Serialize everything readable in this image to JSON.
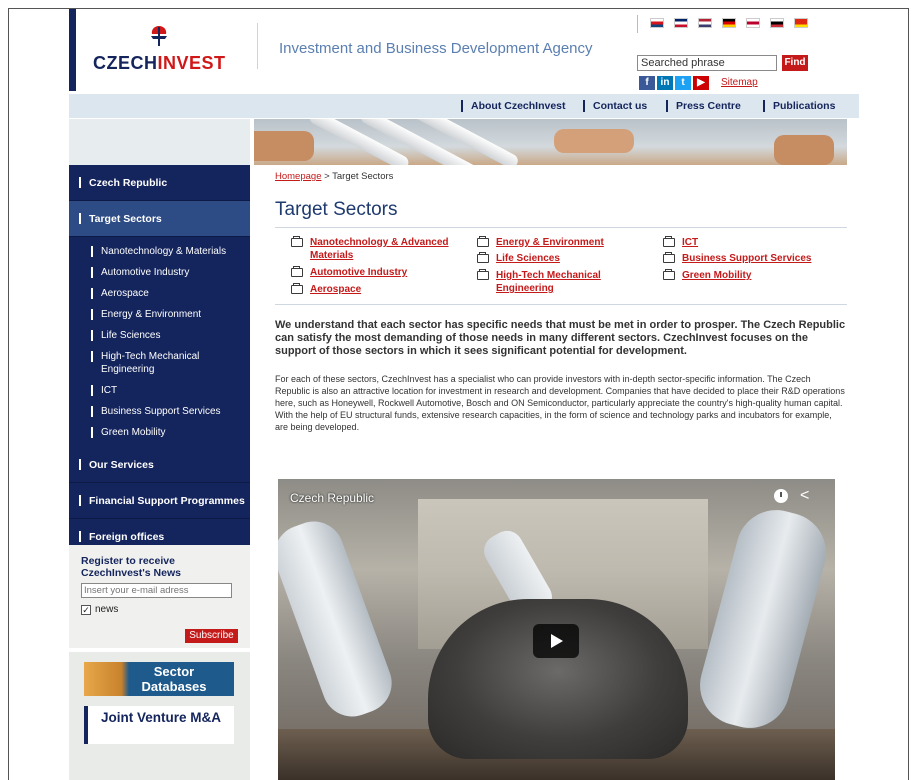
{
  "header": {
    "logo_text_a": "CZECH",
    "logo_text_b": "INVEST",
    "tagline": "Investment and Business Development Agency",
    "search_placeholder": "Searched phrase",
    "find_label": "Find",
    "sitemap_label": "Sitemap",
    "flags": [
      {
        "name": "czech-flag-icon",
        "colors": [
          "#ffffff",
          "#d7141a",
          "#11457e"
        ]
      },
      {
        "name": "uk-flag-icon",
        "colors": [
          "#012169",
          "#ffffff",
          "#c8102e"
        ]
      },
      {
        "name": "us-flag-icon",
        "colors": [
          "#b22234",
          "#ffffff",
          "#3c3b6e"
        ]
      },
      {
        "name": "germany-flag-icon",
        "colors": [
          "#000000",
          "#dd0000",
          "#ffce00"
        ]
      },
      {
        "name": "japan-flag-icon",
        "colors": [
          "#ffffff",
          "#bc002d",
          "#ffffff"
        ]
      },
      {
        "name": "korea-flag-icon",
        "colors": [
          "#ffffff",
          "#000000",
          "#cd2e3a"
        ]
      },
      {
        "name": "china-flag-icon",
        "colors": [
          "#de2910",
          "#de2910",
          "#ffde00"
        ]
      }
    ],
    "social": [
      {
        "name": "facebook-icon",
        "glyph": "f",
        "color": "#3b5998"
      },
      {
        "name": "linkedin-icon",
        "glyph": "in",
        "color": "#0077b5"
      },
      {
        "name": "twitter-icon",
        "glyph": "t",
        "color": "#1da1f2"
      },
      {
        "name": "youtube-icon",
        "glyph": "▶",
        "color": "#cc0000"
      }
    ]
  },
  "topnav": [
    {
      "label": "About CzechInvest"
    },
    {
      "label": "Contact us"
    },
    {
      "label": "Press Centre"
    },
    {
      "label": "Publications"
    }
  ],
  "sidebar": {
    "top_items": [
      {
        "label": "Czech Republic"
      },
      {
        "label": "Target Sectors"
      }
    ],
    "sub_items": [
      {
        "label": "Nanotechnology & Materials"
      },
      {
        "label": "Automotive Industry"
      },
      {
        "label": "Aerospace"
      },
      {
        "label": "Energy & Environment"
      },
      {
        "label": "Life Sciences"
      },
      {
        "label": "High-Tech Mechanical Engineering"
      },
      {
        "label": "ICT"
      },
      {
        "label": "Business Support Services"
      },
      {
        "label": "Green Mobility"
      }
    ],
    "bottom_items": [
      {
        "label": "Our Services"
      },
      {
        "label": "Financial Support Programmes"
      },
      {
        "label": "Foreign offices"
      }
    ],
    "register": {
      "title": "Register to receive CzechInvest's News",
      "email_placeholder": "Insert your e-mail adress",
      "news_label": "news",
      "subscribe_label": "Subscribe"
    },
    "promo1": "Sector Databases",
    "promo2": "Joint Venture M&A"
  },
  "main": {
    "breadcrumb_home": "Homepage",
    "breadcrumb_sep": " > ",
    "breadcrumb_current": "Target Sectors",
    "title": "Target Sectors",
    "sectors": [
      {
        "label": "Nanotechnology & Advanced Materials"
      },
      {
        "label": "Automotive Industry"
      },
      {
        "label": "Aerospace"
      },
      {
        "label": "Energy & Environment"
      },
      {
        "label": "Life Sciences"
      },
      {
        "label": "High-Tech Mechanical Engineering"
      },
      {
        "label": "ICT"
      },
      {
        "label": "Business Support Services"
      },
      {
        "label": "Green Mobility"
      }
    ],
    "lead": "We understand that each sector has specific needs that must be met in order to prosper. The Czech Republic can satisfy the most demanding of those needs in many different sectors. CzechInvest focuses on the support of those sectors in which it sees significant potential for development.",
    "body": "For each of these sectors, CzechInvest has a specialist who can provide investors with in-depth sector-specific information. The Czech Republic is also an attractive location for investment in research and development. Companies that have decided to place their R&D operations here, such as Honeywell, Rockwell Automotive, Bosch and ON Semiconductor, particularly appreciate the country's high-quality human capital. With the help of EU structural funds, extensive research capacities, in the form of science and technology parks and incubators for example, are being developed.",
    "video_title": "Czech Republic"
  }
}
